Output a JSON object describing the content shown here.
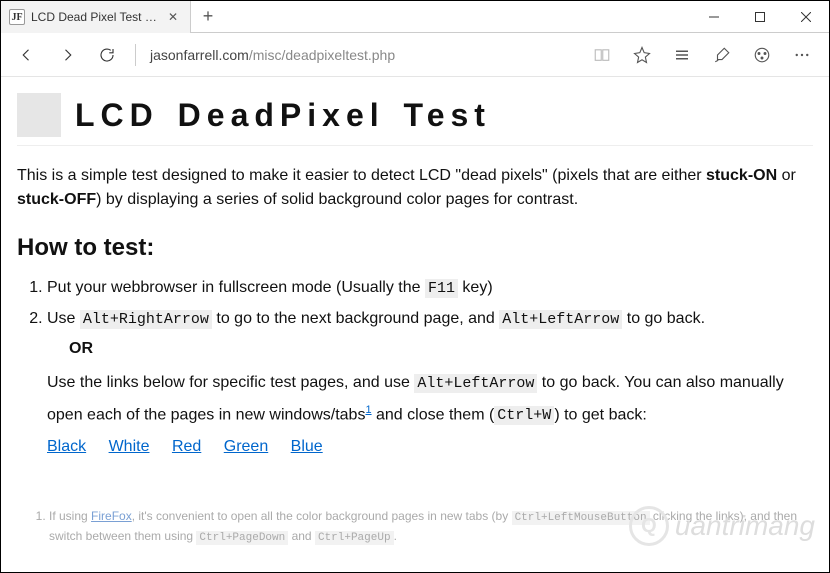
{
  "browser": {
    "tab": {
      "favicon": "JF",
      "title": "LCD Dead Pixel Test Bac"
    },
    "newtab": "+",
    "win": {
      "min": "—",
      "max": "▢",
      "close": "✕"
    }
  },
  "toolbar": {
    "url_host": "jasonfarrell.com",
    "url_path": "/misc/deadpixeltest.php"
  },
  "page": {
    "title": "LCD DeadPixel Test",
    "intro_a": "This is a simple test designed to make it easier to detect LCD \"dead pixels\" (pixels that are either ",
    "intro_b": "stuck-ON",
    "intro_c": " or ",
    "intro_d": "stuck-OFF",
    "intro_e": ") by displaying a series of solid background color pages for contrast.",
    "howto_heading": "How to test:",
    "step1_a": "Put your webbrowser in fullscreen mode (Usually the ",
    "step1_key": "F11",
    "step1_b": " key)",
    "step2_a": "Use ",
    "step2_key1": "Alt+RightArrow",
    "step2_b": " to go to the next background page, and ",
    "step2_key2": "Alt+LeftArrow",
    "step2_c": " to go back.",
    "or_label": "OR",
    "sub_a": "Use the links below for specific test pages, and use ",
    "sub_key1": "Alt+LeftArrow",
    "sub_b": " to go back. You can also manually open each of the pages in new windows/tabs",
    "sup1": "1",
    "sub_c": " and close them (",
    "sub_key2": "Ctrl+W",
    "sub_d": ") to get back:",
    "links": {
      "black": "Black",
      "white": "White",
      "red": "Red",
      "green": "Green",
      "blue": "Blue"
    },
    "footnote": {
      "a": "If using ",
      "firefox": "FireFox",
      "b": ", it's convenient to open all the color background pages in new tabs (by ",
      "key1": "Ctrl+LeftMouseButton",
      "c": " clicking the links), and then switch between them using ",
      "key2": "Ctrl+PageDown",
      "d": " and ",
      "key3": "Ctrl+PageUp",
      "e": "."
    }
  },
  "watermark": {
    "q": "Q",
    "text": "uantrimang"
  }
}
